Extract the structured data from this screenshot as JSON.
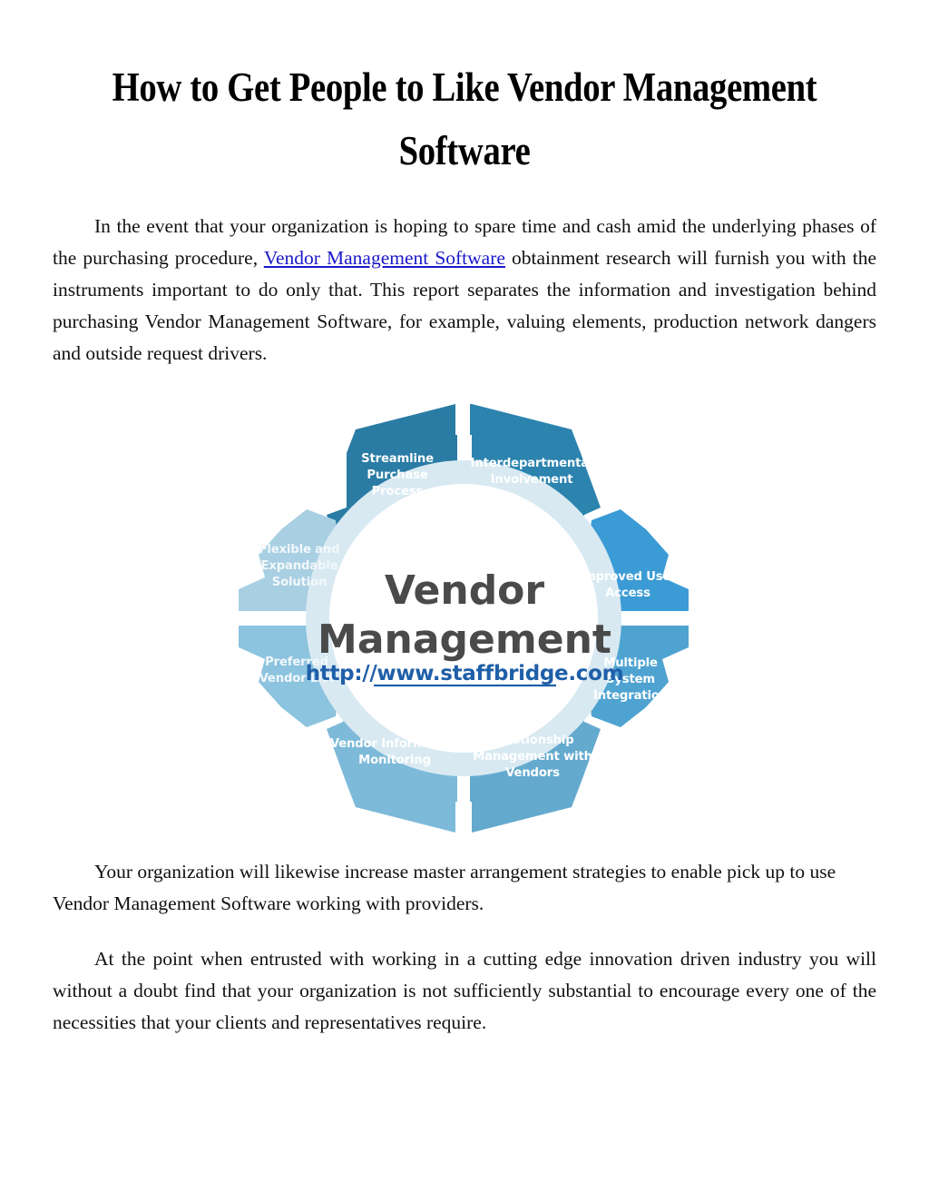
{
  "document": {
    "title": "How to Get People to Like Vendor Management Software",
    "paragraphs": {
      "p1_before_link": "In the event that your organization is hoping to spare time and cash amid the underlying phases of the purchasing procedure, ",
      "p1_link_text": "Vendor Management Software",
      "p1_after_link": " obtainment research will furnish you with the instruments important to do only that. This report separates the information and investigation behind purchasing Vendor Management Software, for example, valuing elements, production network dangers and outside request drivers.",
      "p2": "Your organization will likewise increase master arrangement strategies to enable pick up to use Vendor Management Software working with providers.",
      "p3": "At the point when entrusted with working in a cutting edge innovation driven industry you will without a doubt find that your organization is not sufficiently substantial to encourage every one of the necessities that your clients and representatives require."
    }
  },
  "chart_data": {
    "type": "pie",
    "title": "Vendor Management",
    "subtitle": "http://www.staffbridge.com",
    "legend_position": "none",
    "center_text_color": "#4a4a4a",
    "subtitle_color": "#1f5fa8",
    "inner_ring_color": "#d8e9f2",
    "categories": [
      "Streamline Purchase Process",
      "Interdepartmental Involvement",
      "Improved User Access",
      "Multiple System Integration",
      "Relationship Management with Vendors",
      "Vendor Information Monitoring",
      "Preferred Vendor List",
      "Flexible and Expandable Solution"
    ],
    "values": [
      12.5,
      12.5,
      12.5,
      12.5,
      12.5,
      12.5,
      12.5,
      12.5
    ],
    "colors": [
      "#2a7ca5",
      "#2b83ae",
      "#3b9bd5",
      "#4fa3d1",
      "#64aace",
      "#7db9d9",
      "#8cc3de",
      "#a9cfe2"
    ],
    "segments": [
      {
        "label_lines": [
          "Streamline",
          "Purchase",
          "Process"
        ],
        "color": "#2a7ca5"
      },
      {
        "label_lines": [
          "Interdepartmental",
          "Involvement"
        ],
        "color": "#2b83ae"
      },
      {
        "label_lines": [
          "Improved User",
          "Access"
        ],
        "color": "#3b9bd5"
      },
      {
        "label_lines": [
          "Multiple",
          "System",
          "Integration"
        ],
        "color": "#4fa3d1"
      },
      {
        "label_lines": [
          "Relationship",
          "Management with",
          "Vendors"
        ],
        "color": "#64aace"
      },
      {
        "label_lines": [
          "Vendor Information",
          "Monitoring"
        ],
        "color": "#7db9d9"
      },
      {
        "label_lines": [
          "Preferred",
          "Vendor List"
        ],
        "color": "#8cc3de"
      },
      {
        "label_lines": [
          "Flexible and",
          "Expandable",
          "Solution"
        ],
        "color": "#a9cfe2"
      }
    ]
  }
}
